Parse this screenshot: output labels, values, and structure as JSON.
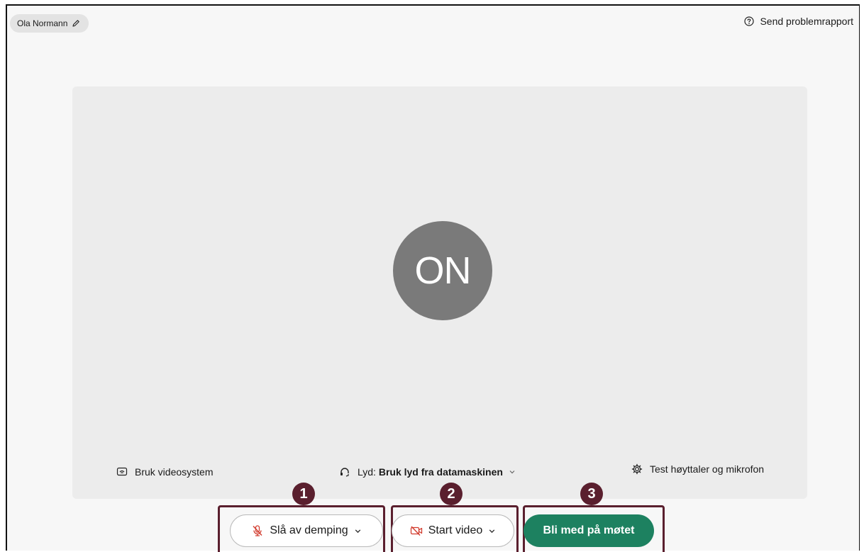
{
  "header": {
    "user_name": "Ola Normann",
    "edit_icon": "pencil-icon",
    "problem_report_label": "Send problemrapport",
    "problem_report_icon": "question-circle-icon"
  },
  "preview": {
    "avatar_initials": "ON",
    "use_video_system_label": "Bruk videosystem",
    "audio_prefix": "Lyd:",
    "audio_value": "Bruk lyd fra datamaskinen",
    "test_devices_label": "Test høyttaler og mikrofon"
  },
  "controls": {
    "unmute_label": "Slå av demping",
    "start_video_label": "Start video",
    "join_label": "Bli med på møtet"
  },
  "callouts": [
    "1",
    "2",
    "3"
  ],
  "colors": {
    "join_button": "#1d8160",
    "callout": "#5a1f2e",
    "muted_icon": "#d23c2e",
    "avatar": "#7a7a7a"
  }
}
